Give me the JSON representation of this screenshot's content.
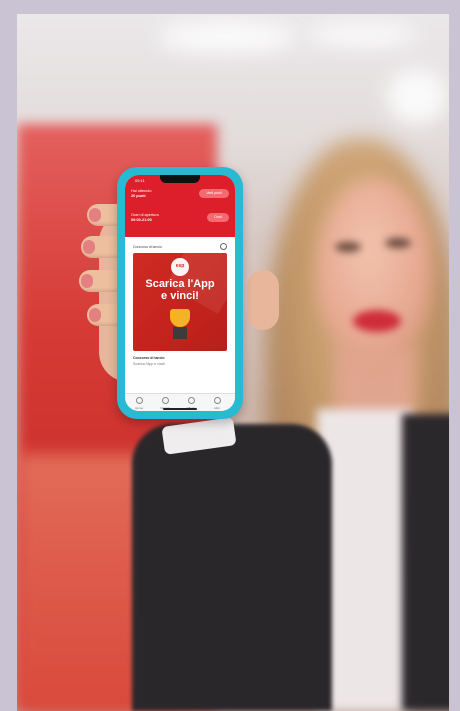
{
  "phone": {
    "status_time": "09:11",
    "header": {
      "points_label": "Hai ottenuto",
      "points_value": "20 punti",
      "points_button": "Vedi punti",
      "hours_label": "Orari di apertura",
      "hours_value": "09:00-21:00",
      "hours_button": "Orari"
    },
    "card": {
      "title": "Concorso di lancio",
      "logo_text": "esp",
      "promo_line1": "Scarica l'App",
      "promo_line2": "e vinci!",
      "contest_title": "Concorso di lancio",
      "contest_sub": "Scarica l'App e vinci!"
    },
    "nav": [
      "Home",
      "Negozi",
      "Offerte",
      "Altro"
    ]
  },
  "colors": {
    "case": "#28b9d3",
    "brand_red": "#dd1f2b",
    "background": "#c9c3d3"
  }
}
